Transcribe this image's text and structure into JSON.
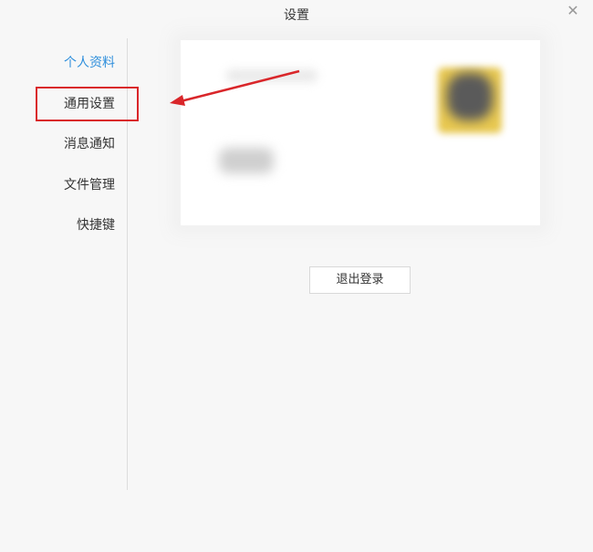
{
  "window": {
    "title": "设置"
  },
  "sidebar": {
    "items": [
      {
        "label": "个人资料",
        "active": true
      },
      {
        "label": "通用设置",
        "active": false
      },
      {
        "label": "消息通知",
        "active": false
      },
      {
        "label": "文件管理",
        "active": false
      },
      {
        "label": "快捷键",
        "active": false
      }
    ]
  },
  "main": {
    "logout_label": "退出登录"
  },
  "colors": {
    "accent": "#2f8fdc",
    "annotation": "#d9262a"
  },
  "icons": {
    "close": "close-icon"
  }
}
